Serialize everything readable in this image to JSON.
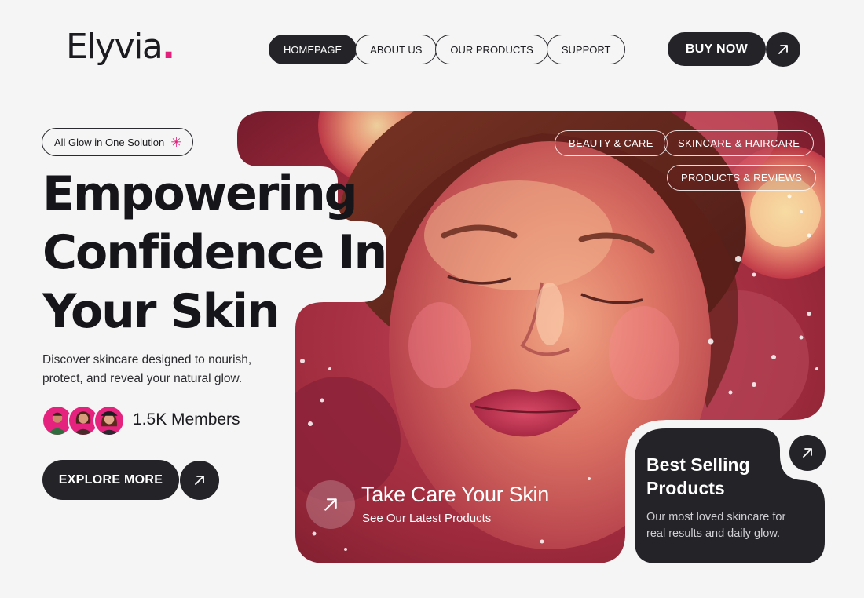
{
  "brand": {
    "name": "Elyvia",
    "dot": ".",
    "accent": "#e4207d"
  },
  "nav": {
    "items": [
      {
        "label": "HOMEPAGE",
        "active": true
      },
      {
        "label": "ABOUT US",
        "active": false
      },
      {
        "label": "OUR PRODUCTS",
        "active": false
      },
      {
        "label": "SUPPORT",
        "active": false
      }
    ],
    "cta_label": "BUY NOW",
    "cta_icon": "arrow-up-right-icon"
  },
  "hero": {
    "badge": {
      "label": "All Glow in One Solution",
      "icon": "sparkle-icon"
    },
    "headline_lines": [
      "Empowering",
      "Confidence In",
      "Your Skin"
    ],
    "description": "Discover skincare designed to nourish, protect, and reveal your natural glow.",
    "members_label": "1.5K Members",
    "explore_label": "EXPLORE MORE",
    "tags": [
      "BEAUTY & CARE",
      "SKINCARE & HAIRCARE",
      "PRODUCTS & REVIEWS"
    ],
    "image_caption": {
      "title": "Take Care Your Skin",
      "subtitle": "See Our Latest Products"
    }
  },
  "best_selling": {
    "title_lines": [
      "Best Selling",
      "Products"
    ],
    "description": "Our most loved skincare for real results and daily glow."
  },
  "colors": {
    "dark": "#232328",
    "background": "#f5f5f5",
    "pink": "#e5237f"
  }
}
